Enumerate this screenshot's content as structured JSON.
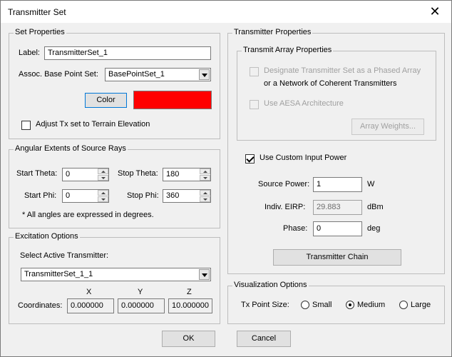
{
  "window": {
    "title": "Transmitter Set",
    "close_glyph": "✕"
  },
  "set_properties": {
    "title": "Set Properties",
    "label_caption": "Label:",
    "label_value": "TransmitterSet_1",
    "base_point_caption": "Assoc. Base Point Set:",
    "base_point_value": "BasePointSet_1",
    "color_button": "Color",
    "color_value": "#ff0000",
    "adjust_caption": "Adjust Tx set to Terrain Elevation",
    "adjust_checked": false
  },
  "angular": {
    "title": "Angular Extents of Source Rays",
    "start_theta_caption": "Start Theta:",
    "start_theta": "0",
    "stop_theta_caption": "Stop Theta:",
    "stop_theta": "180",
    "start_phi_caption": "Start Phi:",
    "start_phi": "0",
    "stop_phi_caption": "Stop Phi:",
    "stop_phi": "360",
    "note": "* All angles are expressed in degrees."
  },
  "excitation": {
    "title": "Excitation Options",
    "select_caption": "Select Active Transmitter:",
    "selected": "TransmitterSet_1_1",
    "coord_caption": "Coordinates:",
    "x_label": "X",
    "y_label": "Y",
    "z_label": "Z",
    "x": "0.000000",
    "y": "0.000000",
    "z": "10.000000"
  },
  "transmitter_properties": {
    "title": "Transmitter Properties",
    "array": {
      "title": "Transmit Array Properties",
      "phased_caption": "Designate Transmitter Set as a Phased Array",
      "phased_caption2": "or a Network of Coherent Transmitters",
      "aesa_caption": "Use AESA Architecture",
      "weights_button": "Array Weights..."
    },
    "custom_power_caption": "Use Custom Input Power",
    "custom_power_checked": true,
    "source_power_caption": "Source Power:",
    "source_power": "1",
    "source_power_unit": "W",
    "eirp_caption": "Indiv. EIRP:",
    "eirp": "29.883",
    "eirp_unit": "dBm",
    "phase_caption": "Phase:",
    "phase": "0",
    "phase_unit": "deg",
    "chain_button": "Transmitter  Chain"
  },
  "visualization": {
    "title": "Visualization Options",
    "point_size_caption": "Tx Point Size:",
    "small": "Small",
    "medium": "Medium",
    "large": "Large",
    "selected": "medium"
  },
  "footer": {
    "ok": "OK",
    "cancel": "Cancel"
  }
}
